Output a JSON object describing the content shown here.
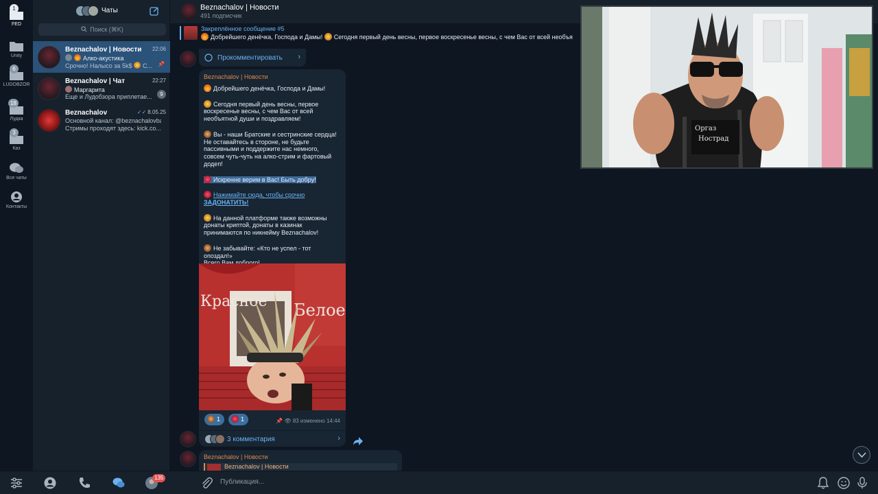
{
  "rail": {
    "folders": [
      {
        "label": "FED",
        "badge": "1"
      },
      {
        "label": "Unity",
        "badge": ""
      },
      {
        "label": "LUDOBZOR",
        "badge": "6"
      },
      {
        "label": "Лудка",
        "badge": "18"
      },
      {
        "label": "Каз",
        "badge": "3"
      },
      {
        "label": "Все чаты",
        "badge": ""
      },
      {
        "label": "Контакты",
        "badge": ""
      }
    ]
  },
  "list": {
    "title": "Чаты",
    "search_placeholder": "Поиск (⌘K)",
    "chats": [
      {
        "name": "Beznachalov | Новости",
        "time": "22:06",
        "sub": "Алко-акустика",
        "msg": "Срочно! Налысо за 5k$",
        "msg_tail": "С..."
      },
      {
        "name": "Beznachalov | Чат",
        "time": "22:27",
        "sub": "Маргарита",
        "msg": "Еще и Лудобзора приплетае...",
        "badge": "9"
      },
      {
        "name": "Beznachalov",
        "time": "8.05.25",
        "sub": "Основной канал: @beznachalovbar",
        "msg": "Стримы проходят здесь: kick.co..."
      }
    ]
  },
  "header": {
    "title": "Beznachalov | Новости",
    "subtitle": "491 подписчик"
  },
  "pinned": {
    "title": "Закреплённое сообщение #5",
    "text": "Добрейшего денёчка, Господа и Дамы!",
    "text2": "Сегодня первый день весны, первое воскресенье весны, с чем Вас от всей необъя"
  },
  "comment_button": "Прокомментировать",
  "post": {
    "author": "Beznachalov | Новости",
    "p1": "Добрейшего денёчка, Господа и Дамы!",
    "p2": "Сегодня первый день весны, первое воскресенье весны, с чем Вас от всей необъятной души и поздравляем!",
    "p3": "Вы - наши Братские и сестринские сердца! Не оставайтесь в стороне, не будьте пассивными и поддержите нас немного, совсем чуть-чуть на алко-стрим и фартовый додеп!",
    "p4": "Искренне верим в Вас! Быть добру!",
    "p5_link": "Нажимайте сюда, чтобы срочно",
    "p5_bold": "ЗАДОНАТИТЬ!",
    "p6": "На данной платформе также возможны донаты криптой, донаты в казинак принимаются по никнейму Beznachalov!",
    "p7": "Не забывайте: «Кто не успел - тот опоздал!»",
    "p8": "Всего Вам доброго!",
    "image_text_left": "Красное",
    "image_text_right": "Белое",
    "reactions": [
      {
        "count": "1"
      },
      {
        "count": "1"
      }
    ],
    "meta": "83 изменено 14:44",
    "comments": "3 комментария"
  },
  "next_post": {
    "author": "Beznachalov | Новости",
    "forward_title": "Beznachalov | Новости"
  },
  "composer": {
    "placeholder": "Публикация..."
  },
  "bottom_badge": "135",
  "colors": {
    "accent": "#6ab3f3",
    "active_chat": "#2b5278",
    "author": "#e08a4a"
  }
}
